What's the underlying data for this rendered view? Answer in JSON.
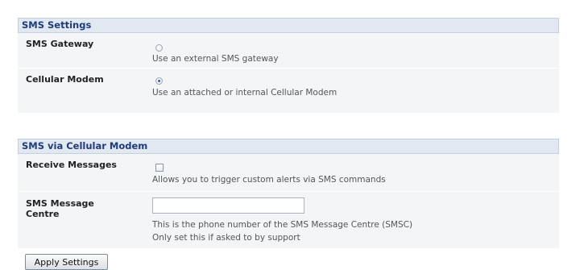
{
  "sms_settings": {
    "header": "SMS Settings",
    "rows": [
      {
        "label": "SMS Gateway",
        "description": "Use an external SMS gateway",
        "selected": false
      },
      {
        "label": "Cellular Modem",
        "description": "Use an attached or internal Cellular Modem",
        "selected": true
      }
    ]
  },
  "sms_via_modem": {
    "header": "SMS via Cellular Modem",
    "receive": {
      "label": "Receive Messages",
      "description": "Allows you to trigger custom alerts via SMS commands",
      "checked": false
    },
    "centre": {
      "label": "SMS Message Centre",
      "value": "",
      "description_line1": "This is the phone number of the SMS Message Centre (SMSC)",
      "description_line2": "Only set this if asked to by support"
    }
  },
  "apply_button": "Apply Settings"
}
